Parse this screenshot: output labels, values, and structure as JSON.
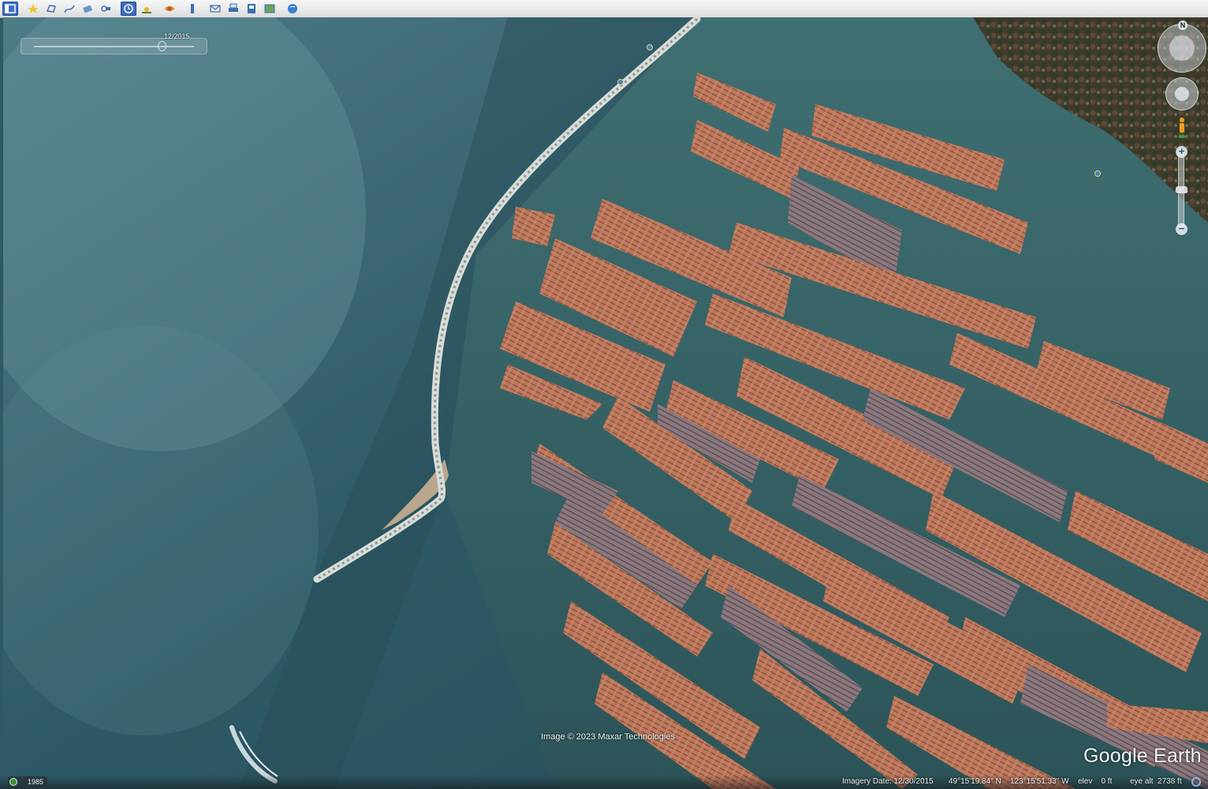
{
  "toolbar": {
    "buttons": [
      {
        "name": "sidebar-toggle-icon",
        "active": true
      },
      {
        "name": "placemark-icon",
        "active": false
      },
      {
        "name": "polygon-icon",
        "active": false
      },
      {
        "name": "path-icon",
        "active": false
      },
      {
        "name": "image-overlay-icon",
        "active": false
      },
      {
        "name": "record-tour-icon",
        "active": false
      },
      {
        "name": "historical-imagery-icon",
        "active": true
      },
      {
        "name": "sunlight-icon",
        "active": false
      },
      {
        "name": "planets-icon",
        "active": false
      },
      {
        "name": "ruler-icon",
        "active": false
      },
      {
        "name": "email-icon",
        "active": false
      },
      {
        "name": "print-icon",
        "active": false
      },
      {
        "name": "save-image-icon",
        "active": false
      },
      {
        "name": "view-in-maps-icon",
        "active": false
      },
      {
        "name": "earth-icon",
        "active": false
      }
    ]
  },
  "time_slider": {
    "label": "12/2015",
    "position_fraction": 0.85
  },
  "navigation": {
    "north_label": "N"
  },
  "attribution": {
    "copyright": "Image © 2023 Maxar Technologies",
    "brand": "Google Earth"
  },
  "status_bar": {
    "history_year": "1985",
    "imagery_date": "Imagery Date: 12/30/2015",
    "latitude": "49°15'19.84\" N",
    "longitude": "123°15'51.33\" W",
    "elevation": "elev    0 ft",
    "eye_altitude": "eye alt  2738 ft"
  },
  "colors": {
    "water_deep": "#264f5a",
    "water_shallow": "#4a7d82",
    "log_boom": "#c8775d",
    "log_boom_grey": "#8a7479",
    "breakwater": "#d8dcd8",
    "shore_forest": "#3f3a2a",
    "toolbar_active": "#3b6fc4"
  }
}
